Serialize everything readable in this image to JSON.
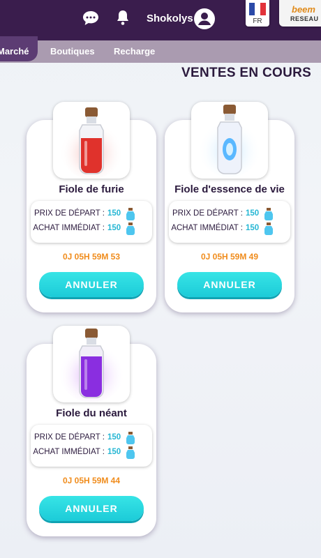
{
  "header": {
    "username": "Shokolys",
    "language": "FR",
    "partner_logo_top": "beem",
    "partner_logo_bottom": "RESEAU",
    "icons": [
      "chat-icon",
      "bell-icon",
      "avatar-icon",
      "flag-fr-icon"
    ]
  },
  "nav": {
    "tabs": [
      {
        "label": "Marché",
        "active": true
      },
      {
        "label": "Boutiques"
      },
      {
        "label": "Recharge"
      }
    ]
  },
  "section_title": "VENTES EN COURS",
  "listings": [
    {
      "name": "Fiole de furie",
      "start_price_label": "PRIX DE DÉPART :",
      "start_price": "150",
      "buy_now_label": "ACHAT IMMÉDIAT :",
      "buy_now_price": "150",
      "timer": "0J 05H 59M 53",
      "button": "ANNULER",
      "potion_color": "#e0322c"
    },
    {
      "name": "Fiole d'essence de vie",
      "start_price_label": "PRIX DE DÉPART :",
      "start_price": "150",
      "buy_now_label": "ACHAT IMMÉDIAT :",
      "buy_now_price": "150",
      "timer": "0J 05H 59M 49",
      "button": "ANNULER",
      "potion_color": "#5ab8ff"
    },
    {
      "name": "Fiole du néant",
      "start_price_label": "PRIX DE DÉPART :",
      "start_price": "150",
      "buy_now_label": "ACHAT IMMÉDIAT :",
      "buy_now_price": "150",
      "timer": "0J 05H 59M 44",
      "button": "ANNULER",
      "potion_color": "#8a2ee0"
    }
  ],
  "colors": {
    "topbar": "#3a1d4d",
    "navbar": "#aa9bb0",
    "accent": "#1ccbd8",
    "timer": "#f08c1c",
    "price": "#27b7d4"
  }
}
